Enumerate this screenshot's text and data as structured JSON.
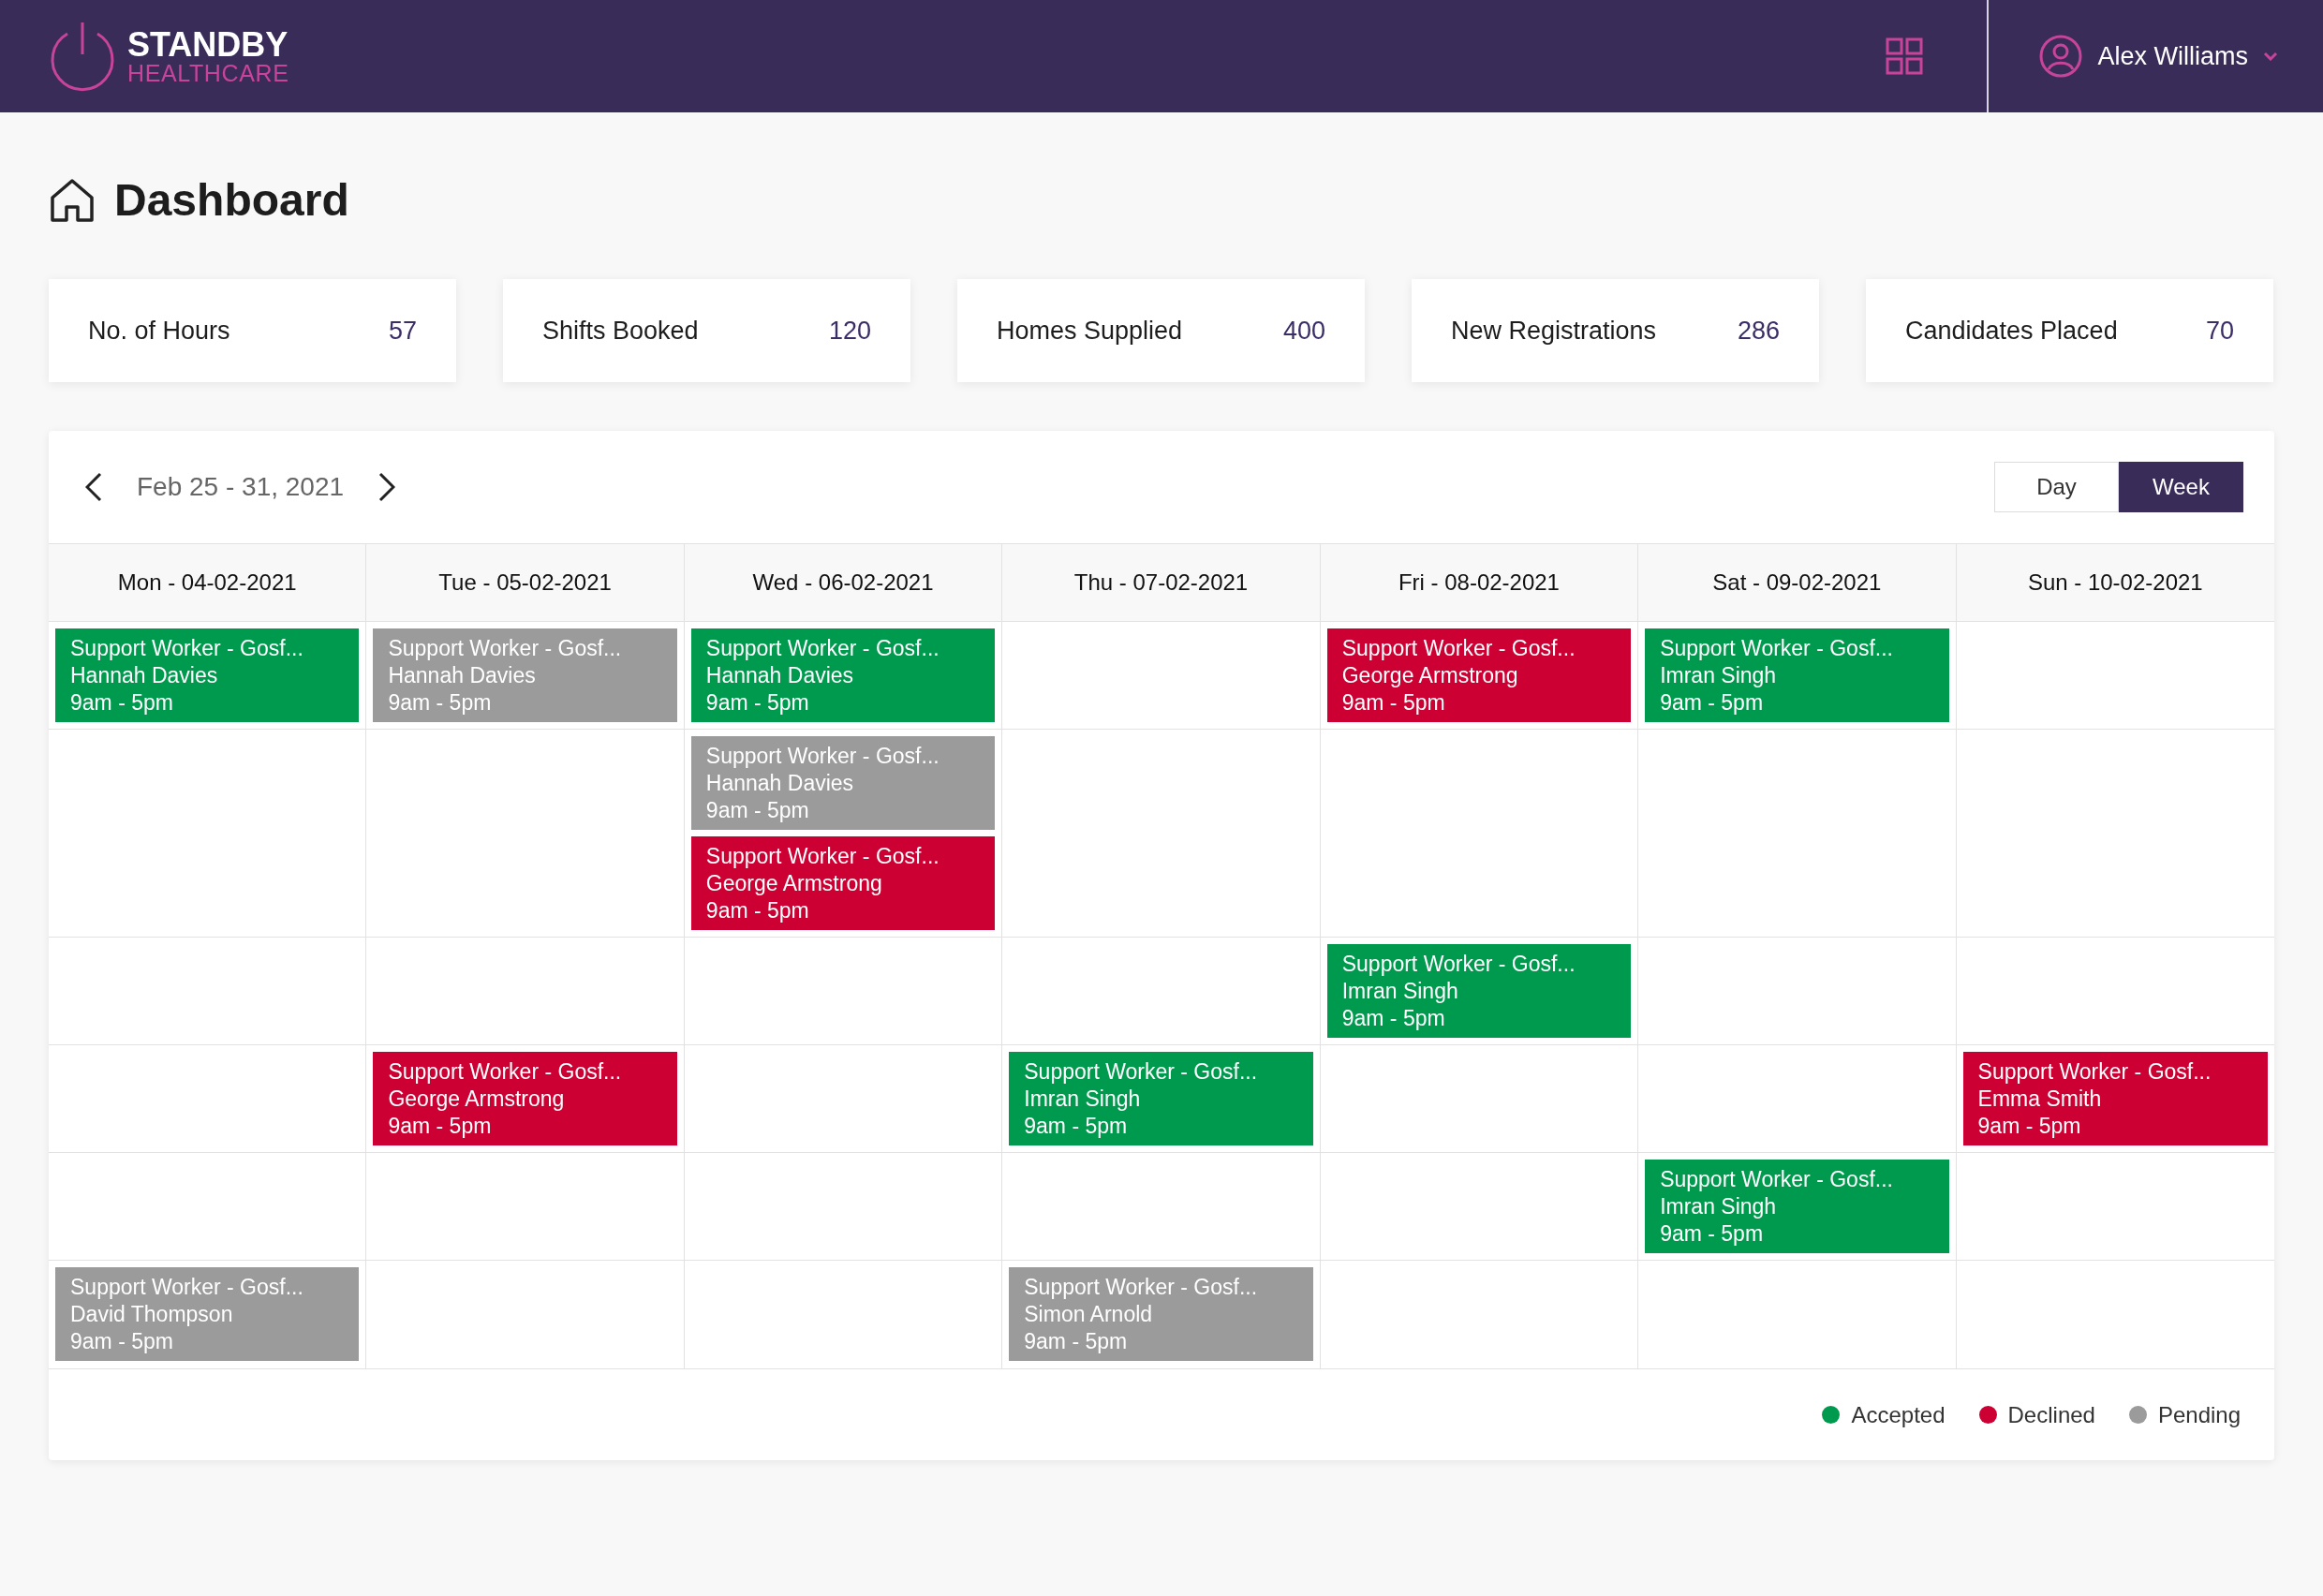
{
  "header": {
    "brand_top": "STANDBY",
    "brand_bottom": "HEALTHCARE",
    "user": "Alex Williams"
  },
  "page_title": "Dashboard",
  "stats": [
    {
      "label": "No. of Hours",
      "value": "57"
    },
    {
      "label": "Shifts Booked",
      "value": "120"
    },
    {
      "label": "Homes Supplied",
      "value": "400"
    },
    {
      "label": "New Registrations",
      "value": "286"
    },
    {
      "label": "Candidates Placed",
      "value": "70"
    }
  ],
  "calendar": {
    "range": "Feb 25 - 31, 2021",
    "views": [
      {
        "label": "Day",
        "selected": false
      },
      {
        "label": "Week",
        "selected": true
      }
    ],
    "days": [
      "Mon - 04-02-2021",
      "Tue - 05-02-2021",
      "Wed - 06-02-2021",
      "Thu - 07-02-2021",
      "Fri - 08-02-2021",
      "Sat - 09-02-2021",
      "Sun - 10-02-2021"
    ],
    "rows": [
      {
        "cells": [
          [
            {
              "title": "Support Worker - Gosf...",
              "name": "Hannah Davies",
              "time": "9am - 5pm",
              "color": "#009a4e"
            }
          ],
          [
            {
              "title": "Support Worker - Gosf...",
              "name": "Hannah Davies",
              "time": "9am - 5pm",
              "color": "#9b9b9b"
            }
          ],
          [
            {
              "title": "Support Worker - Gosf...",
              "name": "Hannah Davies",
              "time": "9am - 5pm",
              "color": "#009a4e"
            }
          ],
          [],
          [
            {
              "title": "Support Worker - Gosf...",
              "name": "George Armstrong",
              "time": "9am - 5pm",
              "color": "#cc0033"
            }
          ],
          [
            {
              "title": "Support Worker - Gosf...",
              "name": "Imran Singh",
              "time": "9am - 5pm",
              "color": "#009a4e"
            }
          ],
          []
        ]
      },
      {
        "cells": [
          [],
          [],
          [
            {
              "title": "Support Worker - Gosf...",
              "name": "Hannah Davies",
              "time": "9am - 5pm",
              "color": "#9b9b9b"
            },
            {
              "title": "Support Worker - Gosf...",
              "name": "George Armstrong",
              "time": "9am - 5pm",
              "color": "#cc0033"
            }
          ],
          [],
          [],
          [],
          []
        ]
      },
      {
        "cells": [
          [],
          [],
          [],
          [],
          [
            {
              "title": "Support Worker - Gosf...",
              "name": "Imran Singh",
              "time": "9am - 5pm",
              "color": "#009a4e"
            }
          ],
          [],
          []
        ]
      },
      {
        "cells": [
          [],
          [
            {
              "title": "Support Worker - Gosf...",
              "name": "George Armstrong",
              "time": "9am - 5pm",
              "color": "#cc0033"
            }
          ],
          [],
          [
            {
              "title": "Support Worker - Gosf...",
              "name": "Imran Singh",
              "time": "9am - 5pm",
              "color": "#009a4e"
            }
          ],
          [],
          [],
          [
            {
              "title": "Support Worker - Gosf...",
              "name": "Emma Smith",
              "time": "9am - 5pm",
              "color": "#cc0033"
            }
          ]
        ]
      },
      {
        "cells": [
          [],
          [],
          [],
          [],
          [],
          [
            {
              "title": "Support Worker - Gosf...",
              "name": "Imran Singh",
              "time": "9am - 5pm",
              "color": "#009a4e"
            }
          ],
          []
        ]
      },
      {
        "cells": [
          [
            {
              "title": "Support Worker - Gosf...",
              "name": "David Thompson",
              "time": "9am - 5pm",
              "color": "#9b9b9b"
            }
          ],
          [],
          [],
          [
            {
              "title": "Support Worker - Gosf...",
              "name": "Simon Arnold",
              "time": "9am - 5pm",
              "color": "#9b9b9b"
            }
          ],
          [],
          [],
          []
        ]
      }
    ],
    "legend": [
      {
        "label": "Accepted",
        "color": "#009a4e"
      },
      {
        "label": "Declined",
        "color": "#cc0033"
      },
      {
        "label": "Pending",
        "color": "#9b9b9b"
      }
    ]
  }
}
